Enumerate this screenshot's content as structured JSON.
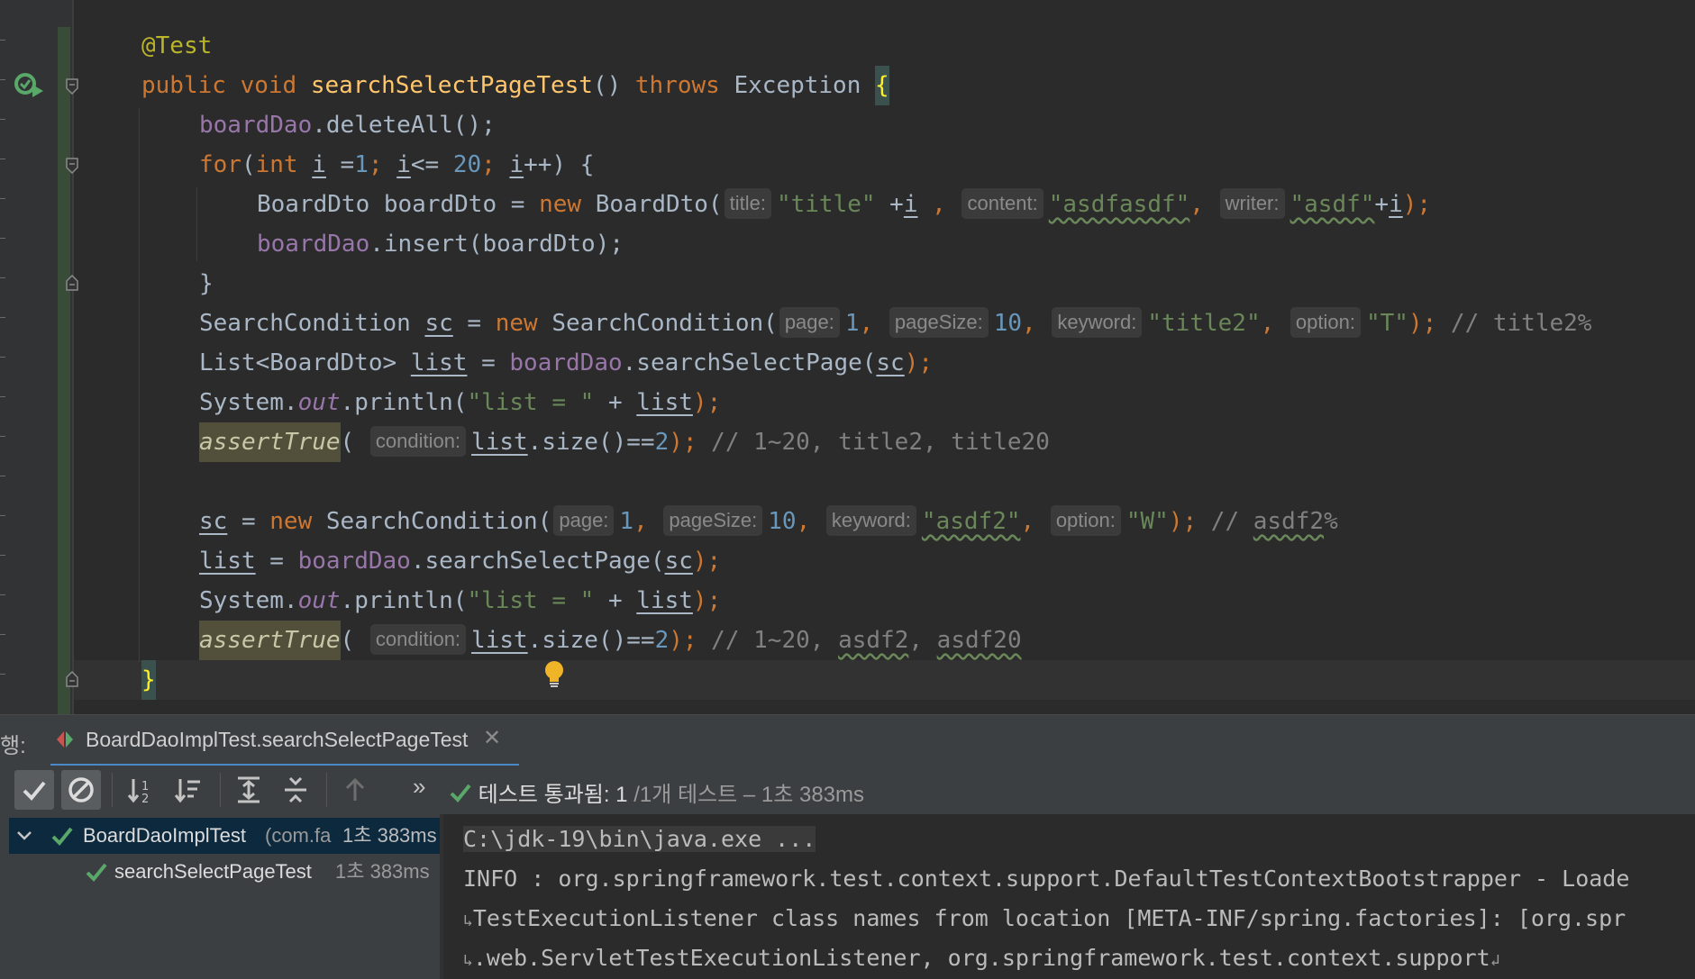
{
  "editor": {
    "annotation": "@Test",
    "method_decl": {
      "public": "public",
      "void": "void",
      "name": "searchSelectPageTest",
      "parens": "()",
      "throws": "throws",
      "exception": "Exception",
      "open_brace": "{"
    },
    "line_delete": {
      "obj": "boardDao",
      "call": ".deleteAll();"
    },
    "line_for": {
      "for": "for",
      "open": "(",
      "int": "int",
      "i1": "i",
      "assign": " =",
      "n1": "1",
      "semi1": ";",
      "i2": "i",
      "le": "<= ",
      "n20": "20",
      "semi2": ";",
      "i3": "i",
      "rest": "++) {"
    },
    "line_new_dto": {
      "type": "BoardDto boardDto = ",
      "new": "new",
      "ctor": " BoardDto(",
      "hint_title": "title:",
      "title_str": "\"title\"",
      "plus": " +",
      "i": "i",
      "comma1": " ,",
      "hint_content": "content:",
      "content_str": "\"asdfasdf\"",
      "comma2": ",",
      "hint_writer": "writer:",
      "writer_str": "\"asdf\"",
      "plus2": "+",
      "i2": "i",
      "close": ");"
    },
    "line_insert": {
      "obj": "boardDao",
      "call": ".insert(boardDto);"
    },
    "close_for": "}",
    "line_sc1": {
      "type": "SearchCondition ",
      "var": "sc",
      "eq": " = ",
      "new": "new",
      "ctor": " SearchCondition(",
      "hint_page": "page:",
      "page": "1",
      "c1": ",",
      "hint_pagesize": "pageSize:",
      "pagesize": "10",
      "c2": ",",
      "hint_keyword": "keyword:",
      "keyword": "\"title2\"",
      "c3": ",",
      "hint_option": "option:",
      "option": "\"T\"",
      "close": ");",
      "comment": " // title2%"
    },
    "line_list1": {
      "type": "List<BoardDto> ",
      "var": "list",
      "eq": " = ",
      "obj": "boardDao",
      "call": ".searchSelectPage(",
      "arg": "sc",
      "close": ");"
    },
    "line_print1": {
      "sys": "System.",
      "out": "out",
      "mid": ".println(",
      "str": "\"list = \"",
      "plus": " + ",
      "var": "list",
      "close": ");"
    },
    "line_assert1": {
      "fn": "assertTrue",
      "open": "(",
      "hint": "condition:",
      "var": "list",
      "mid": ".size()==",
      "num": "2",
      "close": ");",
      "comment": " // 1~20, title2, title20"
    },
    "line_sc2": {
      "var": "sc",
      "eq": " = ",
      "new": "new",
      "ctor": " SearchCondition(",
      "hint_page": "page:",
      "page": "1",
      "c1": ",",
      "hint_pagesize": "pageSize:",
      "pagesize": "10",
      "c2": ",",
      "hint_keyword": "keyword:",
      "keyword": "\"asdf2\"",
      "c3": ",",
      "hint_option": "option:",
      "option": "\"W\"",
      "close": ");",
      "comment_a": " // ",
      "comment_b": "asdf2",
      "comment_c": "%"
    },
    "line_list2": {
      "var": "list",
      "eq": " = ",
      "obj": "boardDao",
      "call": ".searchSelectPage(",
      "arg": "sc",
      "close": ");"
    },
    "line_print2": {
      "sys": "System.",
      "out": "out",
      "mid": ".println(",
      "str": "\"list = \"",
      "plus": " + ",
      "var": "list",
      "close": ");"
    },
    "line_assert2": {
      "fn": "assertTrue",
      "open": "(",
      "hint": "condition:",
      "var": "list",
      "mid": ".size()==",
      "num": "2",
      "close": ");",
      "comment_a": " // 1~20, ",
      "comment_b": "asdf2",
      "comment_c": ", ",
      "comment_d": "asdf20"
    },
    "close_method": "}"
  },
  "run_panel": {
    "label": "행:",
    "tab_label": "BoardDaoImplTest.searchSelectPageTest",
    "tab_close": "✕",
    "more": "»",
    "status": {
      "passed_text": "테스트 통과됨: 1",
      "total_text": "/1개 테스트 – 1초 383ms"
    },
    "tree": [
      {
        "name": "BoardDaoImplTest",
        "pkg": "(com.fa",
        "time": "1초 383ms"
      },
      {
        "name": "searchSelectPageTest",
        "time": "1초 383ms"
      }
    ],
    "console": [
      "C:\\jdk-19\\bin\\java.exe ...",
      "INFO : org.springframework.test.context.support.DefaultTestContextBootstrapper - Loade",
      "TestExecutionListener class names from location [META-INF/spring.factories]: [org.spr",
      ".web.ServletTestExecutionListener, org.springframework.test.context.support"
    ]
  },
  "colors": {
    "editor_bg": "#2b2b2b",
    "keyword": "#cc7832",
    "string": "#6a8759",
    "number": "#6897bb",
    "field": "#9876aa",
    "method": "#ffc66d",
    "annotation": "#bbb529",
    "comment": "#808080",
    "pass_green": "#59a869",
    "selection": "#0d293e"
  },
  "icons": [
    "run-test-icon",
    "fold-icon",
    "lightbulb-icon",
    "test-class-icon",
    "close-icon",
    "check-icon",
    "stop-icon",
    "sort-alpha-icon",
    "sort-duration-icon",
    "expand-all-icon",
    "collapse-all-icon",
    "up-arrow-icon",
    "more-icon",
    "chevron-down-icon",
    "wrap-icon"
  ]
}
